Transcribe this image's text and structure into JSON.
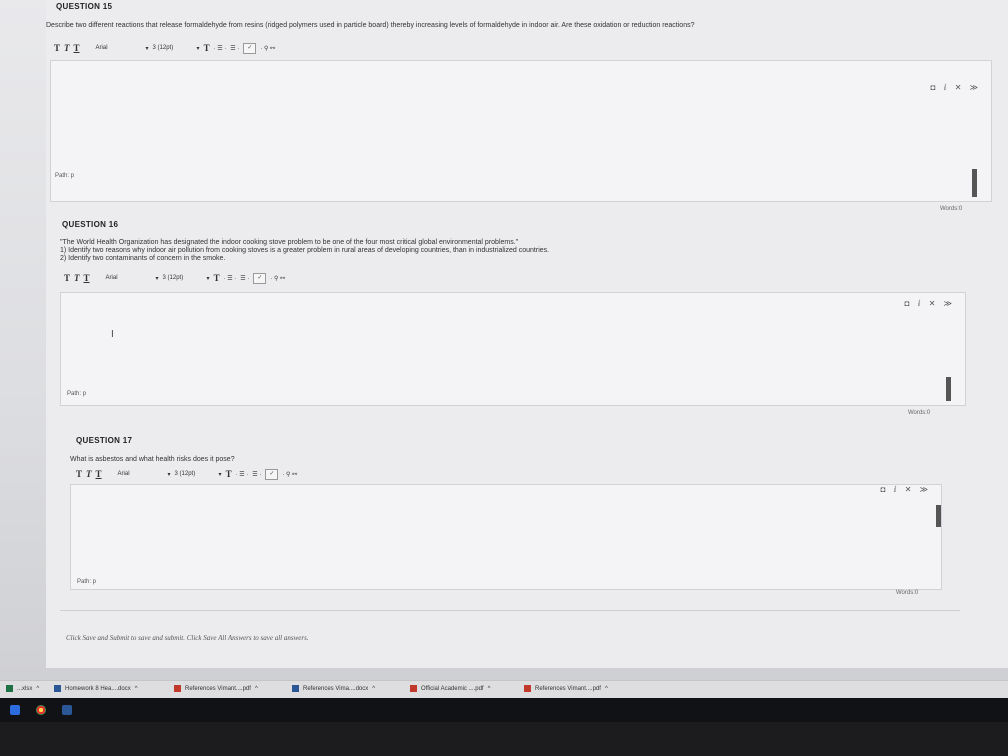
{
  "questions": [
    {
      "header": "QUESTION 15",
      "prompt": [
        "Describe two different reactions that release formaldehyde from resins (ridged polymers used in particle board) thereby increasing levels of formaldehyde in indoor air. Are these oxidation or reduction reactions?"
      ],
      "font": "Arial",
      "size": "3 (12pt)",
      "path": "Path: p",
      "words": "Words:0"
    },
    {
      "header": "QUESTION 16",
      "prompt": [
        "\"The World Health Organization has designated the indoor cooking stove problem to be one of the four most critical global environmental problems.\"",
        "1) Identify two reasons why indoor air pollution from cooking stoves is a greater problem in rural areas of developing countries, than in industrialized countries.",
        "2) Identify two contaminants of concern in the smoke."
      ],
      "font": "Arial",
      "size": "3 (12pt)",
      "path": "Path: p",
      "words": "Words:0"
    },
    {
      "header": "QUESTION 17",
      "prompt": [
        "What is asbestos and what health risks does it pose?"
      ],
      "font": "Arial",
      "size": "3 (12pt)",
      "path": "Path: p",
      "words": "Words:0"
    }
  ],
  "toolbar": {
    "bold": "T",
    "italic": "T",
    "underline": "T",
    "text_color": "T"
  },
  "footer": "Click Save and Submit to save and submit. Click Save All Answers to save all answers.",
  "downloads": [
    {
      "name": "...xlsx",
      "icon": "excel-icon"
    },
    {
      "name": "Homework 8 Hea....docx",
      "icon": "word-icon"
    },
    {
      "name": "References Vimant....pdf",
      "icon": "pdf-icon"
    },
    {
      "name": "References Vima....docx",
      "icon": "word-icon"
    },
    {
      "name": "Official Academic ....pdf",
      "icon": "pdf-icon"
    },
    {
      "name": "References Vimant....pdf",
      "icon": "pdf-icon"
    }
  ],
  "colors": {
    "pdf": "#c0392b",
    "word": "#2b5797",
    "excel": "#1e7145"
  }
}
